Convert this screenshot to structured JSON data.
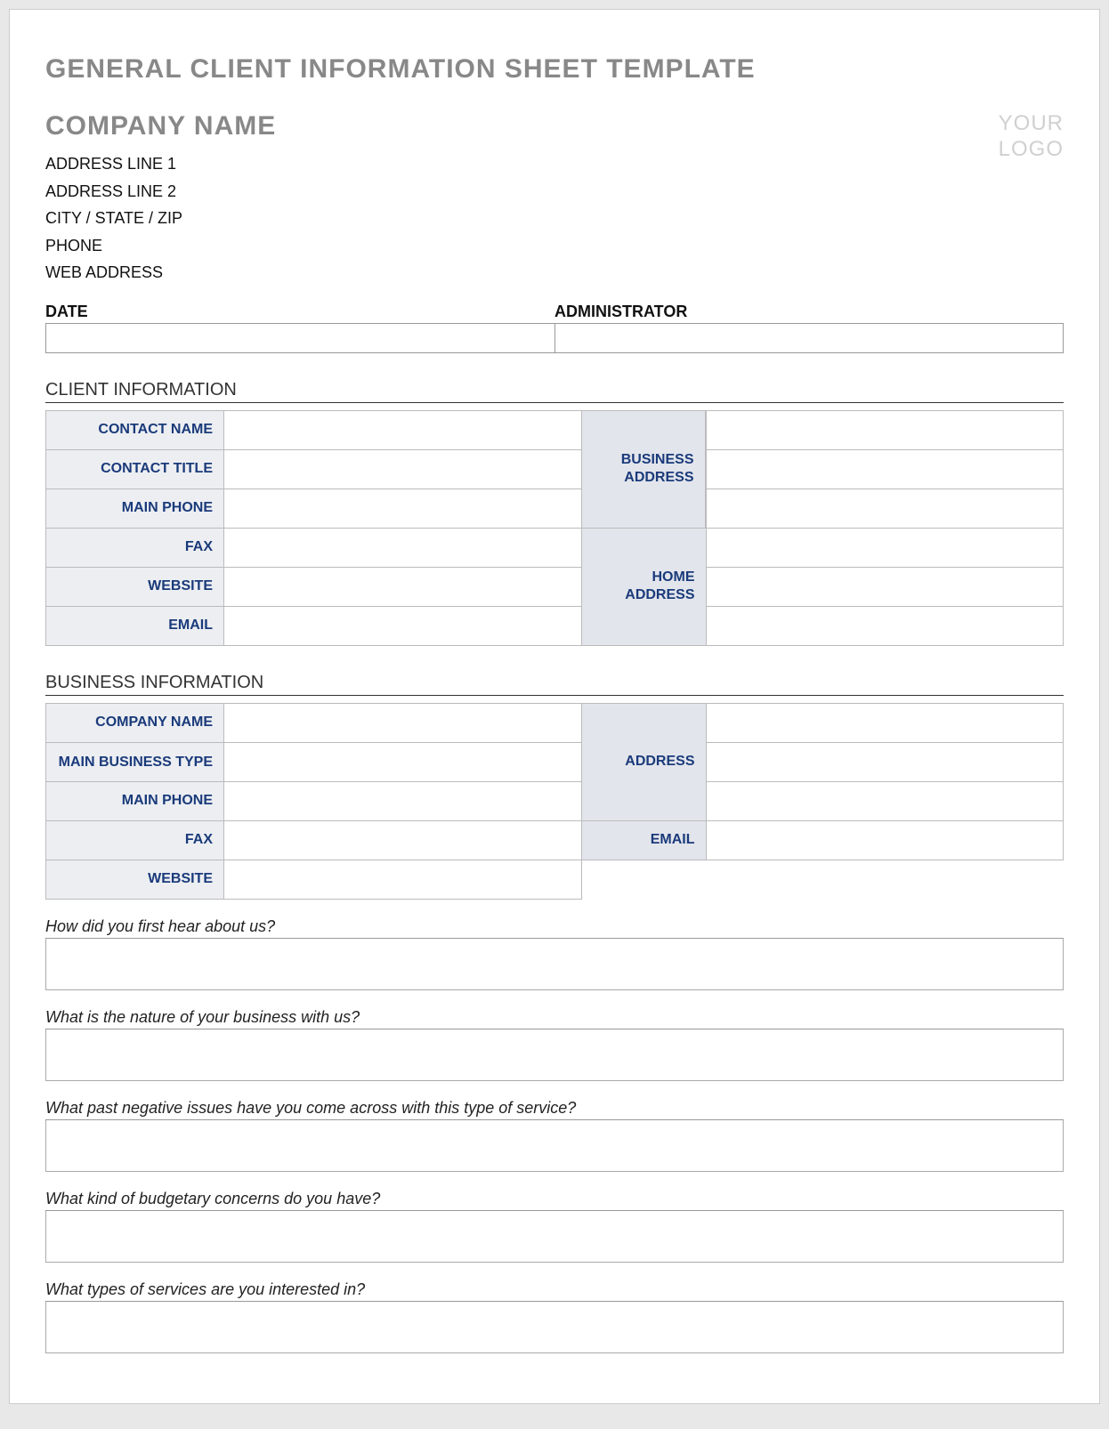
{
  "title": "GENERAL CLIENT INFORMATION SHEET TEMPLATE",
  "logo_text_line1": "YOUR",
  "logo_text_line2": "LOGO",
  "company": {
    "name": "COMPANY NAME",
    "lines": [
      "ADDRESS LINE 1",
      "ADDRESS LINE 2",
      "CITY / STATE / ZIP",
      "PHONE",
      "WEB ADDRESS"
    ]
  },
  "date_admin": {
    "date_label": "DATE",
    "admin_label": "ADMINISTRATOR",
    "date_value": "",
    "admin_value": ""
  },
  "sections": {
    "client_info_title": "CLIENT INFORMATION",
    "business_info_title": "BUSINESS INFORMATION"
  },
  "client_info": {
    "contact_name": "CONTACT NAME",
    "contact_title": "CONTACT TITLE",
    "main_phone": "MAIN PHONE",
    "fax": "FAX",
    "website": "WEBSITE",
    "email": "EMAIL",
    "business_address": "BUSINESS ADDRESS",
    "home_address": "HOME ADDRESS"
  },
  "business_info": {
    "company_name": "COMPANY NAME",
    "main_business_type": "MAIN BUSINESS TYPE",
    "main_phone": "MAIN PHONE",
    "fax": "FAX",
    "website": "WEBSITE",
    "address": "ADDRESS",
    "email": "EMAIL"
  },
  "questions": [
    "How did you first hear about us?",
    "What is the nature of your business with us?",
    "What past negative issues have you come across with this type of service?",
    "What kind of budgetary concerns do you have?",
    "What types of services are you interested in?"
  ]
}
